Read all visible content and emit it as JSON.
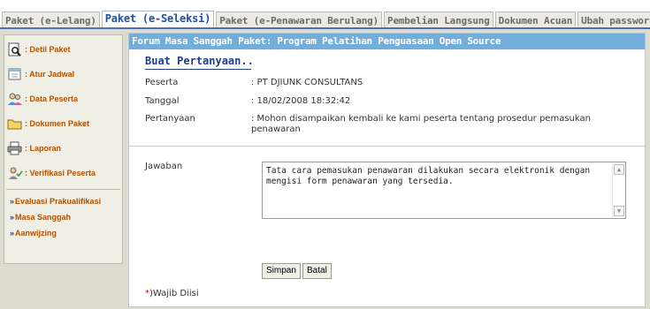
{
  "tabs": [
    {
      "label": "Paket (e-Lelang)",
      "active": false
    },
    {
      "label": "Paket (e-Seleksi)",
      "active": true
    },
    {
      "label": "Paket (e-Penawaran Berulang)",
      "active": false
    },
    {
      "label": "Pembelian Langsung",
      "active": false
    },
    {
      "label": "Dokumen Acuan",
      "active": false
    },
    {
      "label": "Ubah password",
      "active": false
    }
  ],
  "sidebar": {
    "items": [
      {
        "label": ": Detil Paket",
        "icon": "magnifier-document-icon"
      },
      {
        "label": ": Atur Jadwal",
        "icon": "calendar-icon"
      },
      {
        "label": ": Data Peserta",
        "icon": "users-icon"
      },
      {
        "label": ": Dokumen Paket",
        "icon": "folder-icon"
      },
      {
        "label": ": Laporan",
        "icon": "printer-icon"
      },
      {
        "label": ": Verifikasi Peserta",
        "icon": "verify-user-icon"
      }
    ],
    "links": [
      {
        "arrow": "»",
        "label": "Evaluasi Prakualifikasi"
      },
      {
        "arrow": "»",
        "label": "Masa Sanggah"
      },
      {
        "arrow": "»",
        "label": "Aanwijzing"
      }
    ]
  },
  "forum": {
    "title": "Forum Masa Sanggah Paket: Program Pelatihan Penguasaan Open Source",
    "heading": "Buat Pertanyaan..",
    "peserta_label": "Peserta",
    "peserta_value": ": PT DJIUNK CONSULTANS",
    "tanggal_label": "Tanggal",
    "tanggal_value": ": 18/02/2008 18:32:42",
    "pertanyaan_label": "Pertanyaan",
    "pertanyaan_value": ": Mohon disampaikan kembali ke kami peserta tentang prosedur pemasukan penawaran",
    "jawaban_label": "Jawaban",
    "jawaban_value": "Tata cara pemasukan penawaran dilakukan secara elektronik dengan mengisi form penawaran yang tersedia.",
    "simpan_label": "Simpan",
    "batal_label": "Batal",
    "wajib_star": "*",
    "wajib_text": ")Wajib Diisi"
  },
  "colors": {
    "accent": "#1f4fa3",
    "header_bar": "#72aedb",
    "sidebar_text": "#b25000",
    "required": "#cc0000"
  }
}
